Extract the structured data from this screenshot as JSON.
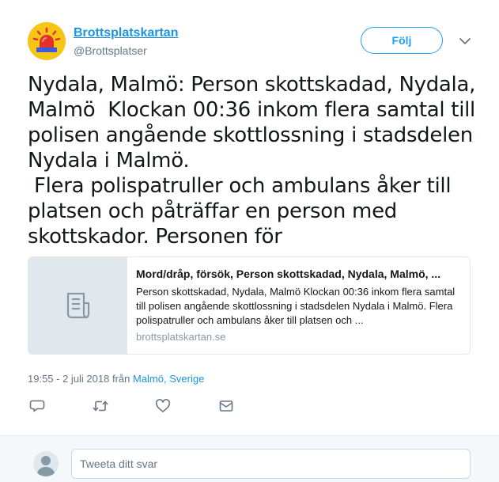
{
  "user": {
    "name": "Brottsplatskartan",
    "handle": "@Brottsplatser"
  },
  "follow_label": "Följ",
  "tweet_text": "Nydala, Malmö: Person skottskadad, Nydala,\nMalmö  Klockan 00:36 inkom flera samtal till\npolisen angående skottlossning i stadsdelen\nNydala i Malmö.\n Flera polispatruller och ambulans åker till\nplatsen och påträffar en person med\nskottskador. Personen för",
  "card": {
    "title": "Mord/dråp, försök, Person skottskadad, Nydala, Malmö, ...",
    "description": "Person skottskadad, Nydala, Malmö Klockan 00:36 inkom flera samtal till polisen angående skottlossning i stadsdelen Nydala i Malmö. Flera polispatruller och ambulans åker till platsen och ...",
    "domain": "brottsplatskartan.se",
    "icon": "document-icon"
  },
  "meta": {
    "timestamp": "19:55 - 2 juli 2018 från ",
    "location": "Malmö, Sverige"
  },
  "actions": [
    "reply-icon",
    "retweet-icon",
    "like-icon",
    "message-icon"
  ],
  "reply": {
    "placeholder": "Tweeta ditt svar"
  },
  "colors": {
    "link": "#1b95e0",
    "accent": "#1da1f2",
    "muted": "#657786"
  }
}
